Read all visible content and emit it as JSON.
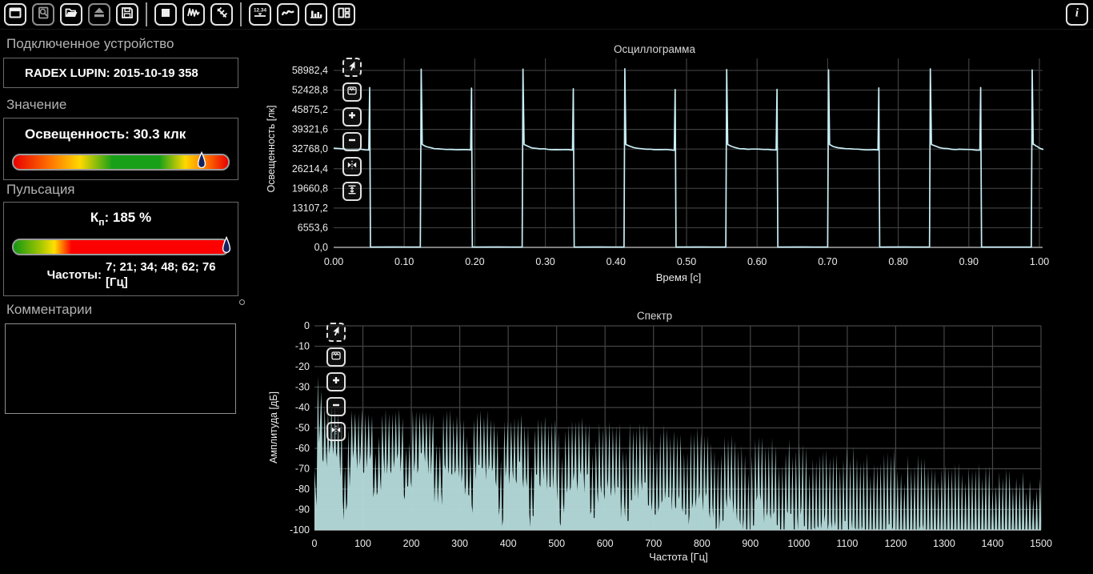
{
  "toolbar": {
    "groups": [
      [
        {
          "name": "window",
          "disabled": false
        },
        {
          "name": "preview",
          "disabled": true
        },
        {
          "name": "open-folder",
          "disabled": false
        },
        {
          "name": "eject",
          "disabled": true
        },
        {
          "name": "save",
          "disabled": false
        }
      ],
      [
        {
          "name": "stop",
          "disabled": false
        },
        {
          "name": "waveform",
          "disabled": false
        },
        {
          "name": "sweep",
          "disabled": false
        }
      ],
      [
        {
          "name": "measurement",
          "disabled": false
        },
        {
          "name": "curve-view",
          "disabled": false
        },
        {
          "name": "bars-view",
          "disabled": false
        },
        {
          "name": "layout",
          "disabled": false
        }
      ]
    ],
    "measurement_icon_text": "12.34",
    "info_label": "i"
  },
  "sidebar": {
    "device_section": {
      "header": "Подключенное устройство",
      "device": "RADEX LUPIN: 2015-10-19 358"
    },
    "value_section": {
      "header": "Значение",
      "value_label": "Освещенность: 30.3 клк",
      "gradient": [
        "#e80000 0%",
        "#ff7300 17%",
        "#ffd800 31%",
        "#18a018 46%",
        "#18a018 68%",
        "#ffd800 80%",
        "#ff7300 90%",
        "#e80000 100%"
      ],
      "marker_pos": 0.872,
      "marker_color": "#14235f"
    },
    "pulsation_section": {
      "header": "Пульсация",
      "kp_label": "К",
      "kp_sub": "п",
      "kp_value": ":  185 %",
      "gradient": [
        "#139613 0%",
        "#a8c800 13%",
        "#ffe000 19%",
        "#ff0000 27%",
        "#ff0000 100%"
      ],
      "marker_pos": 0.985,
      "marker_color": "#14235f",
      "freq_label": "Частоты:",
      "freq_value": "7; 21; 34; 48; 62; 76",
      "freq_unit": "[Гц]"
    },
    "comments_section": {
      "header": "Комментарии",
      "text": ""
    }
  },
  "chart_tools": {
    "oscillogram": [
      "pointer",
      "autorange",
      "zoom-in",
      "zoom-out",
      "fit-horizontal",
      "fit-vertical"
    ],
    "spectrum": [
      "pointer",
      "autorange",
      "zoom-in",
      "zoom-out",
      "fit-horizontal"
    ]
  },
  "chart_data": [
    {
      "type": "line",
      "title": "Осциллограмма",
      "xlabel": "Время [с]",
      "ylabel": "Освещенность [лк]",
      "xlim": [
        0,
        1.0
      ],
      "ylim": [
        0,
        65536
      ],
      "grid": true,
      "x_ticks": [
        {
          "v": 0.0,
          "label": "0.00"
        },
        {
          "v": 0.1,
          "label": "0.10"
        },
        {
          "v": 0.2,
          "label": "0.20"
        },
        {
          "v": 0.3,
          "label": "0.30"
        },
        {
          "v": 0.4,
          "label": "0.40"
        },
        {
          "v": 0.5,
          "label": "0.50"
        },
        {
          "v": 0.6,
          "label": "0.60"
        },
        {
          "v": 0.7,
          "label": "0.70"
        },
        {
          "v": 0.8,
          "label": "0.80"
        },
        {
          "v": 0.9,
          "label": "0.90"
        },
        {
          "v": 1.0,
          "label": "1.00"
        }
      ],
      "y_ticks": [
        {
          "v": 58982.4,
          "label": "58982,4"
        },
        {
          "v": 52428.8,
          "label": "52428,8"
        },
        {
          "v": 45875.2,
          "label": "45875,2"
        },
        {
          "v": 39321.6,
          "label": "39321,6"
        },
        {
          "v": 32768.0,
          "label": "32768,0"
        },
        {
          "v": 26214.4,
          "label": "26214,4"
        },
        {
          "v": 19660.8,
          "label": "19660,8"
        },
        {
          "v": 13107.2,
          "label": "13107,2"
        },
        {
          "v": 6553.6,
          "label": "6553,6"
        },
        {
          "v": 0.0,
          "label": "0,0"
        }
      ],
      "color": "#c9eef6",
      "signal": {
        "shape": "square-pulse",
        "frequency_hz": 7,
        "period_s": 0.1443,
        "first_fall_s": 0.051,
        "first_rise_s": 0.124,
        "high_level_start": 34300,
        "high_level_end": 32460,
        "low_level": 120,
        "rise_spike": 59400,
        "fall_spike": 52900,
        "t_end": 1.007
      }
    },
    {
      "type": "area",
      "title": "Спектр",
      "xlabel": "Частота [Гц]",
      "ylabel": "Амплитуда [дБ]",
      "xlim": [
        0,
        1500
      ],
      "ylim": [
        -100,
        0
      ],
      "grid": true,
      "x_ticks": [
        {
          "v": 0,
          "label": "0"
        },
        {
          "v": 100,
          "label": "100"
        },
        {
          "v": 200,
          "label": "200"
        },
        {
          "v": 300,
          "label": "300"
        },
        {
          "v": 400,
          "label": "400"
        },
        {
          "v": 500,
          "label": "500"
        },
        {
          "v": 600,
          "label": "600"
        },
        {
          "v": 700,
          "label": "700"
        },
        {
          "v": 800,
          "label": "800"
        },
        {
          "v": 900,
          "label": "900"
        },
        {
          "v": 1000,
          "label": "1000"
        },
        {
          "v": 1100,
          "label": "1100"
        },
        {
          "v": 1200,
          "label": "1200"
        },
        {
          "v": 1300,
          "label": "1300"
        },
        {
          "v": 1400,
          "label": "1400"
        },
        {
          "v": 1500,
          "label": "1500"
        }
      ],
      "y_ticks": [
        {
          "v": 0,
          "label": "0"
        },
        {
          "v": -10,
          "label": "-10"
        },
        {
          "v": -20,
          "label": "-20"
        },
        {
          "v": -30,
          "label": "-30"
        },
        {
          "v": -40,
          "label": "-40"
        },
        {
          "v": -50,
          "label": "-50"
        },
        {
          "v": -60,
          "label": "-60"
        },
        {
          "v": -70,
          "label": "-70"
        },
        {
          "v": -80,
          "label": "-80"
        },
        {
          "v": -90,
          "label": "-90"
        },
        {
          "v": -100,
          "label": "-100"
        }
      ],
      "color": "#b5dcdb",
      "comb_spacing_hz": 7,
      "envelope_db": [
        [
          3,
          -55
        ],
        [
          7,
          -20
        ],
        [
          11,
          -29
        ],
        [
          14,
          -33
        ],
        [
          20,
          -40
        ],
        [
          28,
          -43
        ],
        [
          60,
          -43.5
        ],
        [
          150,
          -44
        ],
        [
          250,
          -45
        ],
        [
          350,
          -46
        ],
        [
          450,
          -47.5
        ],
        [
          550,
          -49.5
        ],
        [
          650,
          -51.5
        ],
        [
          750,
          -54
        ],
        [
          850,
          -58
        ],
        [
          950,
          -61
        ],
        [
          1050,
          -63.5
        ],
        [
          1150,
          -65.5
        ],
        [
          1250,
          -68.5
        ],
        [
          1350,
          -72.5
        ],
        [
          1450,
          -77
        ],
        [
          1500,
          -81
        ]
      ],
      "notch_period_hz": 64,
      "notch_depth_db": 30,
      "valley_offset_db": 16,
      "noise_floor_db": -100
    }
  ]
}
